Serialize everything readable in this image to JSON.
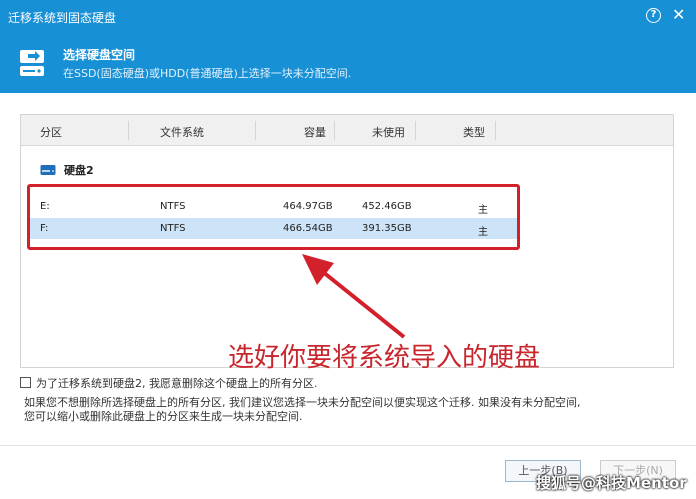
{
  "window": {
    "title": "迁移系统到固态硬盘",
    "help_label": "?",
    "close_label": "✕"
  },
  "header": {
    "icon": "disk-transfer-icon",
    "title": "选择硬盘空间",
    "description": "在SSD(固态硬盘)或HDD(普通硬盘)上选择一块未分配空间."
  },
  "table": {
    "columns": [
      "分区",
      "文件系统",
      "容量",
      "未使用",
      "类型"
    ],
    "disk_label": "硬盘2",
    "rows": [
      {
        "partition": "E:",
        "fs": "NTFS",
        "capacity": "464.97GB",
        "unused": "452.46GB",
        "type": "主",
        "selected": false
      },
      {
        "partition": "F:",
        "fs": "NTFS",
        "capacity": "466.54GB",
        "unused": "391.35GB",
        "type": "主",
        "selected": true
      }
    ]
  },
  "annotation": "选好你要将系统导入的硬盘",
  "confirm": {
    "label": "为了迁移系统到硬盘2, 我愿意删除这个硬盘上的所有分区.",
    "checked": false
  },
  "note": {
    "line1": "如果您不想删除所选择硬盘上的所有分区, 我们建议您选择一块未分配空间以便实现这个迁移. 如果没有未分配空间,",
    "line2": "您可以缩小或删除此硬盘上的分区来生成一块未分配空间."
  },
  "buttons": {
    "prev": "上一步(B)",
    "next": "下一步(N)"
  },
  "watermark": "搜狐号@科技Mentor",
  "colors": {
    "accent": "#1890d6",
    "highlight": "#d3212c",
    "selected_row": "#cde3f7"
  }
}
